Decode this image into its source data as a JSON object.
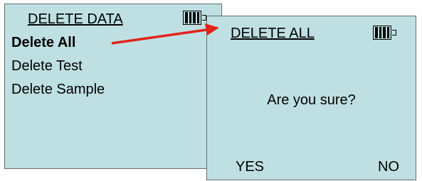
{
  "left_screen": {
    "title": "DELETE DATA",
    "menu_items": [
      {
        "label": "Delete All",
        "selected": true
      },
      {
        "label": "Delete Test",
        "selected": false
      },
      {
        "label": "Delete Sample",
        "selected": false
      }
    ],
    "battery_icon": "battery-full-icon"
  },
  "right_screen": {
    "title": "DELETE ALL",
    "prompt": "Are you sure?",
    "softkeys": {
      "yes": "YES",
      "no": "NO"
    },
    "battery_icon": "battery-full-icon"
  },
  "arrow_icon": "arrow-right-icon",
  "colors": {
    "screen_bg": "#bfe0e2",
    "arrow": "#e2231a",
    "text": "#000000"
  }
}
